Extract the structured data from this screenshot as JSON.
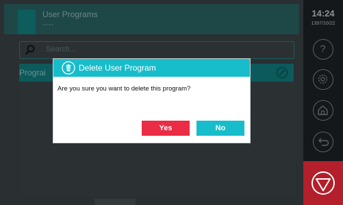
{
  "header": {
    "title": "User Programs",
    "subtitle": "----"
  },
  "search": {
    "placeholder": "Search..."
  },
  "list": {
    "column_label": "Prograi"
  },
  "side_panel": {
    "time": "14:24",
    "date": "1397/10/22",
    "buttons": [
      "help-icon",
      "settings-icon",
      "home-icon",
      "back-icon",
      "stop-icon"
    ]
  },
  "dialog": {
    "title": "Delete User Program",
    "message": "Are you sure you want to delete this program?",
    "yes_label": "Yes",
    "no_label": "No",
    "icon": "trash-icon"
  },
  "colors": {
    "accent": "#18bdcb",
    "danger": "#ea2c44",
    "stop": "#b31f2a",
    "header_bg": "#1e4747"
  }
}
